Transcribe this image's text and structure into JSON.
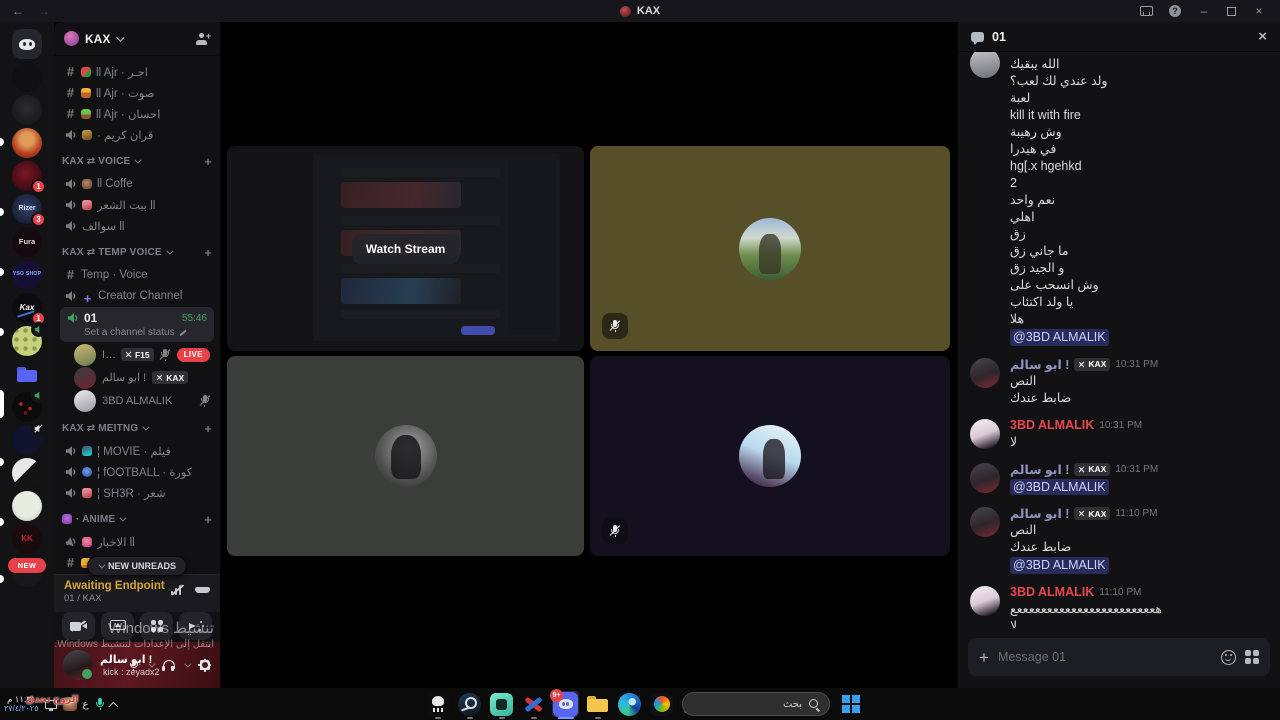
{
  "titlebar": {
    "title": "KAX",
    "back": "←",
    "forward": "→",
    "help": "?",
    "minimize": "–",
    "close": "×"
  },
  "rail": {
    "new_badge": "NEW",
    "servers": [
      {
        "name": "home",
        "label": "",
        "cls": "home",
        "dlogo": true
      },
      {
        "name": "server",
        "label": "",
        "cls": "sv-ar"
      },
      {
        "name": "server",
        "label": "",
        "cls": "sv-dark"
      },
      {
        "name": "server",
        "label": "",
        "cls": "sv-face"
      },
      {
        "name": "server",
        "label": "",
        "cls": "sv-crim",
        "badge": "1"
      },
      {
        "name": "server",
        "label": "Rizer",
        "cls": "sv-rizer",
        "badge": "3"
      },
      {
        "name": "server",
        "label": "Fura",
        "cls": "sv-fura"
      },
      {
        "name": "server",
        "label": "YSO SHOP",
        "cls": "sv-yso"
      },
      {
        "name": "server",
        "label": "Kax",
        "cls": "sv-kaxs",
        "badge": "1"
      },
      {
        "name": "server",
        "label": "",
        "cls": "sv-cheese",
        "voice": "von"
      },
      {
        "name": "server-folder",
        "label": "",
        "cls": "sv-folder",
        "folder": true
      },
      {
        "name": "server",
        "label": "",
        "cls": "sv-reddots",
        "voice": "von"
      },
      {
        "name": "server",
        "label": "",
        "cls": "sv-navy",
        "voice": "vmut"
      },
      {
        "name": "server",
        "label": "",
        "cls": "sv-bw"
      },
      {
        "name": "server",
        "label": "",
        "cls": "sv-sketch"
      },
      {
        "name": "server",
        "label": "KK",
        "cls": "sv-kk"
      },
      {
        "name": "server",
        "label": "",
        "cls": "sv-part"
      }
    ]
  },
  "sidebar": {
    "server_name": "KAX",
    "channels_a": [
      {
        "hash": true,
        "dot": "d-melon",
        "label": "ll Ajr · اجـر"
      },
      {
        "hash": true,
        "dot": "d-circus",
        "label": "ll Ajr · صوت"
      },
      {
        "hash": true,
        "dot": "d-plant",
        "label": "ll Ajr · احسان"
      },
      {
        "spk": true,
        "dot": "d-quran",
        "label": "قران كريم ·",
        "dir": "rtl"
      }
    ],
    "sect_voice": "KAX ⇄ VOICE",
    "channels_b": [
      {
        "spk": true,
        "dot": "d-coffee",
        "label": "ll Coffe"
      },
      {
        "spk": true,
        "dot": "d-pinkmic",
        "label": "ll بيت الشعر",
        "dir": "rtl"
      },
      {
        "spk": true,
        "label": "ll سوالف",
        "dir": "rtl"
      }
    ],
    "sect_temp": "KAX ⇄ TEMP VOICE",
    "channels_t": [
      {
        "hash": true,
        "label": "Temp · Voice"
      },
      {
        "spk": true,
        "dot": "d-plusp",
        "dot_glyph": "+",
        "label": "Creator Channel"
      }
    ],
    "active": {
      "label": "01",
      "timer": "55:46",
      "status": "Set a channel status"
    },
    "members": [
      {
        "av": "av-m1",
        "name": "I'm back",
        "tag": "F15",
        "muted": true,
        "live": "LIVE"
      },
      {
        "av": "av-m2",
        "name": "ابو سالم !",
        "tag": "KAX"
      },
      {
        "av": "av-m3",
        "name": "3BD ALMALIK",
        "muted": true
      }
    ],
    "sect_meitng": "KAX ⇄ MEITNG",
    "channels_c": [
      {
        "spk": true,
        "dot": "d-film",
        "label": "¦ MOVIE · فيلم"
      },
      {
        "spk": true,
        "dot": "d-globe",
        "label": "¦ fOOTBALL · كورة"
      },
      {
        "spk": true,
        "dot": "d-pinkmic",
        "label": "¦ SH3R · شعر"
      }
    ],
    "sect_anime": "· ANIME",
    "channels_d": [
      {
        "mega": true,
        "dot": "d-pink",
        "label": "ll الاخبار",
        "dir": "rtl"
      },
      {
        "hash": true,
        "dot": "d-warn",
        "label": "ll …",
        "dir": "rtl"
      }
    ],
    "unreads_pill": "NEW UNREADS",
    "voice_status": {
      "title": "Awaiting Endpoint",
      "sub": "01 / KAX"
    },
    "user": {
      "name": "ابو سالم !",
      "sub": "kick : zeyadx2"
    },
    "watermark": {
      "l1": "تنشيط Windows",
      "l2": "انتقل إلى الإعدادات لتنشيط Windows."
    }
  },
  "stage": {
    "watch_button": "Watch Stream"
  },
  "chat": {
    "title": "01",
    "cont": [
      {
        "text": "الله يبقيك"
      },
      {
        "text": "ولد عندي لك لعب؟"
      },
      {
        "text": "لعبة"
      },
      {
        "text": "kill it with fire"
      },
      {
        "text": "وش رهيبة"
      },
      {
        "text": "في هيدرا"
      },
      {
        "text": "hg[.x hgehkd"
      },
      {
        "text": "2"
      },
      {
        "text": "نعم واحد"
      },
      {
        "text": "اهلي"
      },
      {
        "text": "زق"
      },
      {
        "text": "ما جاني زق"
      },
      {
        "text": "و الجيد زق"
      },
      {
        "text": "وش انسحب على"
      },
      {
        "text": "يا ولد اكتئاب"
      },
      {
        "text": "هلا"
      },
      {
        "text": "@3BD ALMALIK",
        "cls": "mention"
      }
    ],
    "groups": [
      {
        "av": "cav-a",
        "name": "ابو سالم !",
        "ncls": "name-slate",
        "tag": "KAX",
        "time": "10:31 PM",
        "lines": [
          {
            "text": "النص"
          },
          {
            "text": "ضابط عندك"
          }
        ]
      },
      {
        "av": "cav-b",
        "name": "3BD ALMALIK",
        "ncls": "name-red",
        "time": "10:31 PM",
        "lines": [
          {
            "text": "لا"
          }
        ]
      },
      {
        "av": "cav-a",
        "name": "ابو سالم !",
        "ncls": "name-slate",
        "tag": "KAX",
        "time": "10:31 PM",
        "lines": [
          {
            "text": "@3BD ALMALIK",
            "cls": "mention"
          }
        ]
      },
      {
        "av": "cav-a",
        "name": "ابو سالم !",
        "ncls": "name-slate",
        "tag": "KAX",
        "time": "11:10 PM",
        "lines": [
          {
            "text": "النص"
          },
          {
            "text": "ضابط عندك"
          },
          {
            "text": "@3BD ALMALIK",
            "cls": "mention"
          }
        ]
      },
      {
        "av": "cav-b",
        "name": "3BD ALMALIK",
        "ncls": "name-red",
        "time": "11:10 PM",
        "lines": [
          {
            "text": "هعععععععععععععععععععععععع"
          },
          {
            "text": "لا"
          }
        ]
      }
    ],
    "input_placeholder": "Message 01"
  },
  "taskbar": {
    "search": "بحث",
    "discord_badge": "9+",
    "tray": {
      "time": "١١:٣١ م",
      "date": "٢٧/٤/٢٠٢٥",
      "lang": "ع",
      "overlay": "الروح تحدق"
    }
  }
}
